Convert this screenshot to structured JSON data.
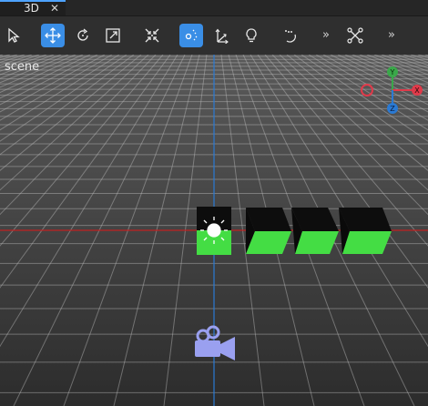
{
  "tab": {
    "label": "3D",
    "close": "✕"
  },
  "toolbar": {
    "tools": [
      {
        "name": "select-tool",
        "active": false
      },
      {
        "name": "move-tool",
        "active": true
      },
      {
        "name": "rotate-tool",
        "active": false
      },
      {
        "name": "scale-tool",
        "active": false
      },
      {
        "name": "transform-tool",
        "active": false
      },
      {
        "name": "snap-tool",
        "active": true
      },
      {
        "name": "pivot-tool",
        "active": false
      },
      {
        "name": "light-tool",
        "active": false
      },
      {
        "name": "curve-tool",
        "active": false
      },
      {
        "name": "more-tool",
        "active": false
      },
      {
        "name": "node-tool",
        "active": false
      },
      {
        "name": "more-tool-2",
        "active": false
      }
    ],
    "more_label": "»"
  },
  "viewport": {
    "label": "scene"
  },
  "gizmo": {
    "y_label": "Y",
    "x_label": "X",
    "z_label": "Z",
    "colors": {
      "x": "#e03a4a",
      "y": "#3aa84a",
      "z": "#2a7ad4"
    }
  },
  "colors": {
    "accent": "#3a8ee6",
    "cube_top": "#0d0d0d",
    "cube_front": "#44dd44",
    "camera": "#9aa0f0"
  }
}
